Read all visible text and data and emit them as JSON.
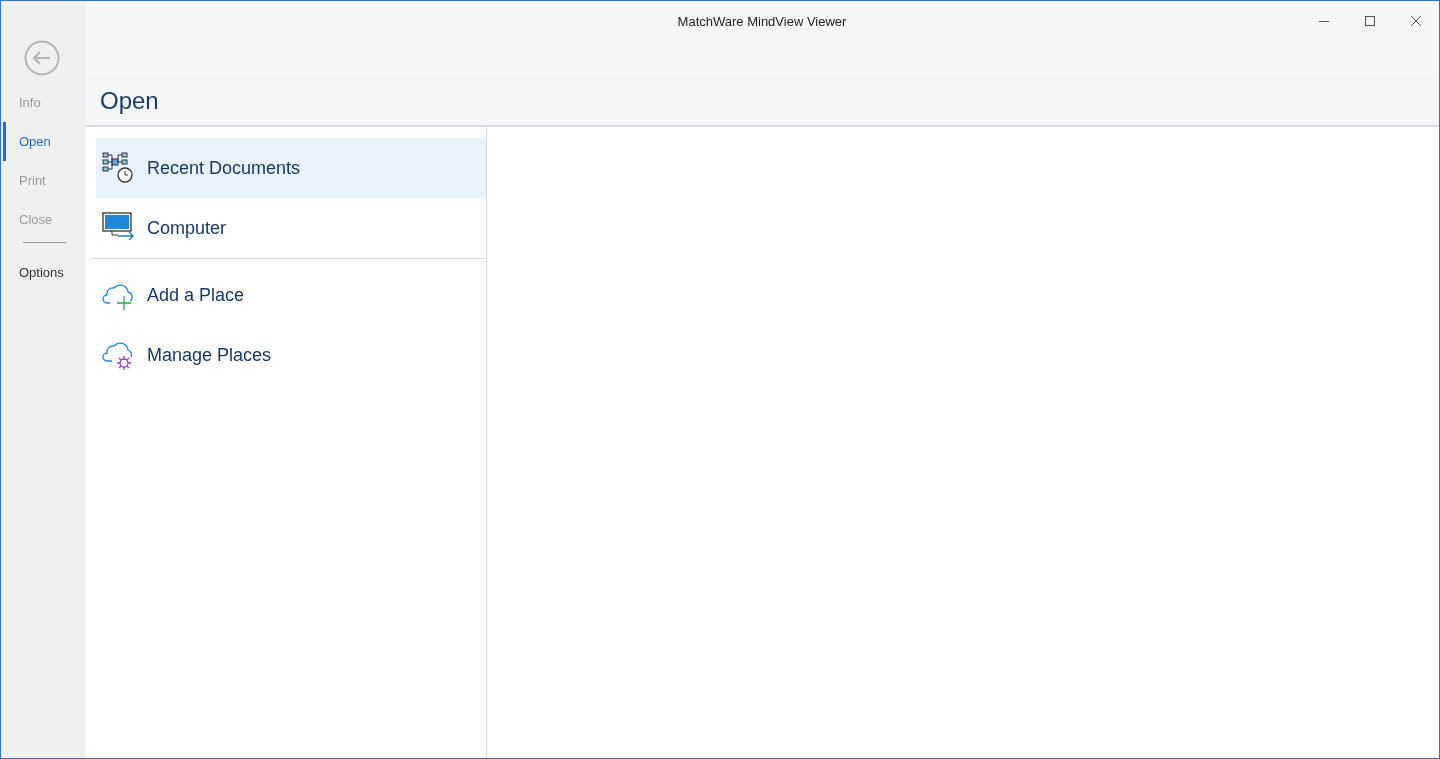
{
  "window": {
    "title": "MatchWare MindView Viewer"
  },
  "sidebar": {
    "items": [
      {
        "label": "Info",
        "selected": false,
        "disabled": true
      },
      {
        "label": "Open",
        "selected": true,
        "disabled": false
      },
      {
        "label": "Print",
        "selected": false,
        "disabled": true
      },
      {
        "label": "Close",
        "selected": false,
        "disabled": true
      },
      {
        "label": "Options",
        "selected": false,
        "disabled": false,
        "divider_before": true
      }
    ]
  },
  "page": {
    "heading": "Open"
  },
  "places": {
    "groups": [
      [
        {
          "label": "Recent Documents",
          "kind": "recent",
          "selected": true
        },
        {
          "label": "Computer",
          "kind": "computer",
          "selected": false
        }
      ],
      [
        {
          "label": "Add a Place",
          "kind": "add",
          "selected": false
        },
        {
          "label": "Manage Places",
          "kind": "manage",
          "selected": false
        }
      ]
    ]
  }
}
